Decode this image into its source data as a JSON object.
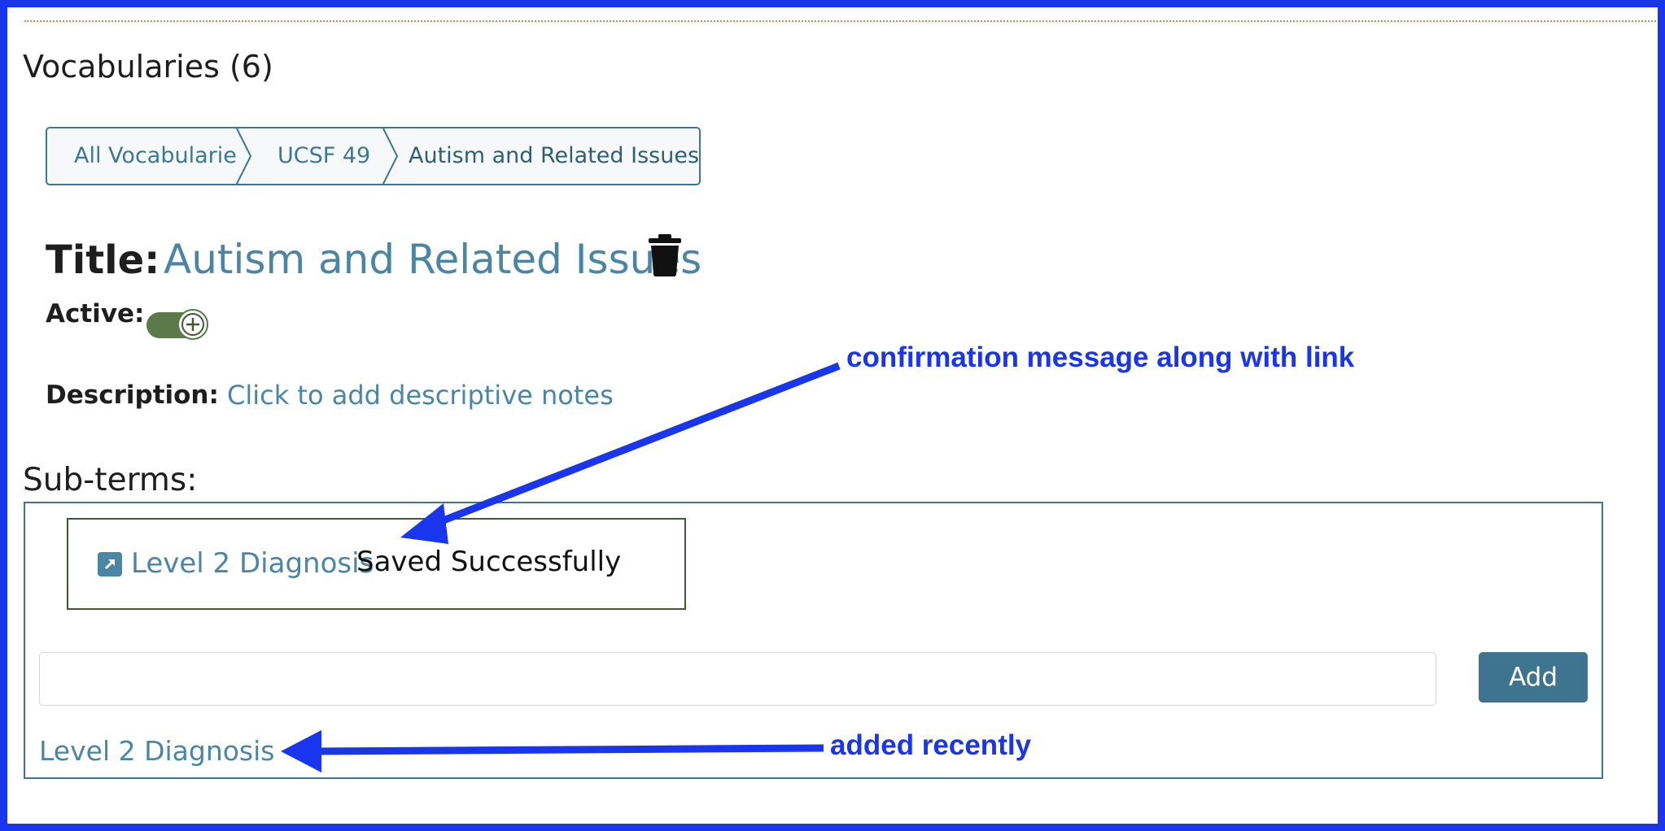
{
  "page": {
    "heading": "Vocabularies (6)"
  },
  "breadcrumb": {
    "items": [
      {
        "label": "All Vocabularies"
      },
      {
        "label": "UCSF 49"
      },
      {
        "label": "Autism and Related Issues"
      }
    ]
  },
  "vocabulary": {
    "title_label": "Title:",
    "title_value": "Autism and Related Issues",
    "active_label": "Active:",
    "active": true,
    "description_label": "Description:",
    "description_placeholder": "Click to add descriptive notes"
  },
  "subterms": {
    "heading": "Sub-terms:",
    "confirmation": {
      "link_text": "Level 2 Diagnosis",
      "message": "Saved Successfully"
    },
    "input_value": "",
    "add_label": "Add",
    "items": [
      {
        "label": "Level 2 Diagnosis"
      }
    ]
  },
  "annotations": {
    "confirmation_note": "confirmation message along with link",
    "recent_note": "added recently",
    "color": "#1a35ee"
  },
  "colors": {
    "link": "#4a86a4",
    "button": "#3f7490",
    "toggle": "#5a7a4a",
    "frame": "#1a35ee"
  },
  "icons": {
    "delete": "trash-icon",
    "toggle": "plus-circle-icon",
    "link": "external-link-icon"
  }
}
